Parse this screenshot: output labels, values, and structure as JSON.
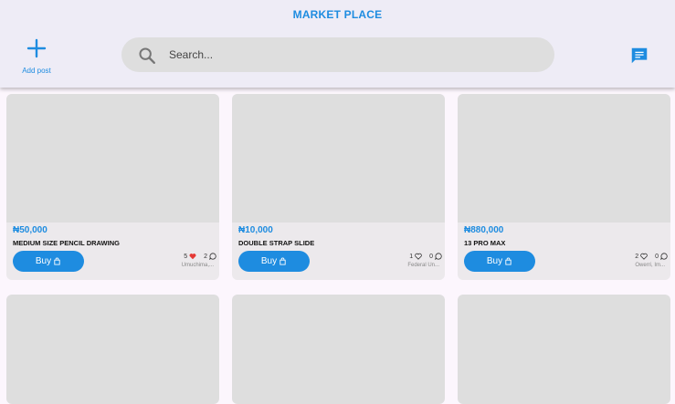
{
  "header": {
    "title": "MARKET PLACE",
    "add_post_label": "Add post",
    "search_placeholder": "Search..."
  },
  "colors": {
    "accent": "#1e8ce0",
    "like_red": "#e53935"
  },
  "products": [
    {
      "price": "₦50,000",
      "name": "MEDIUM SIZE PENCIL DRAWING",
      "buy_label": "Buy",
      "likes": "5",
      "liked": true,
      "comments": "2",
      "location": "Umuchima,..."
    },
    {
      "price": "₦10,000",
      "name": "DOUBLE STRAP SLIDE",
      "buy_label": "Buy",
      "likes": "1",
      "liked": false,
      "comments": "0",
      "location": "Federal Un..."
    },
    {
      "price": "₦880,000",
      "name": "13 PRO MAX",
      "buy_label": "Buy",
      "likes": "2",
      "liked": false,
      "comments": "0",
      "location": "Owerri, Im..."
    }
  ]
}
